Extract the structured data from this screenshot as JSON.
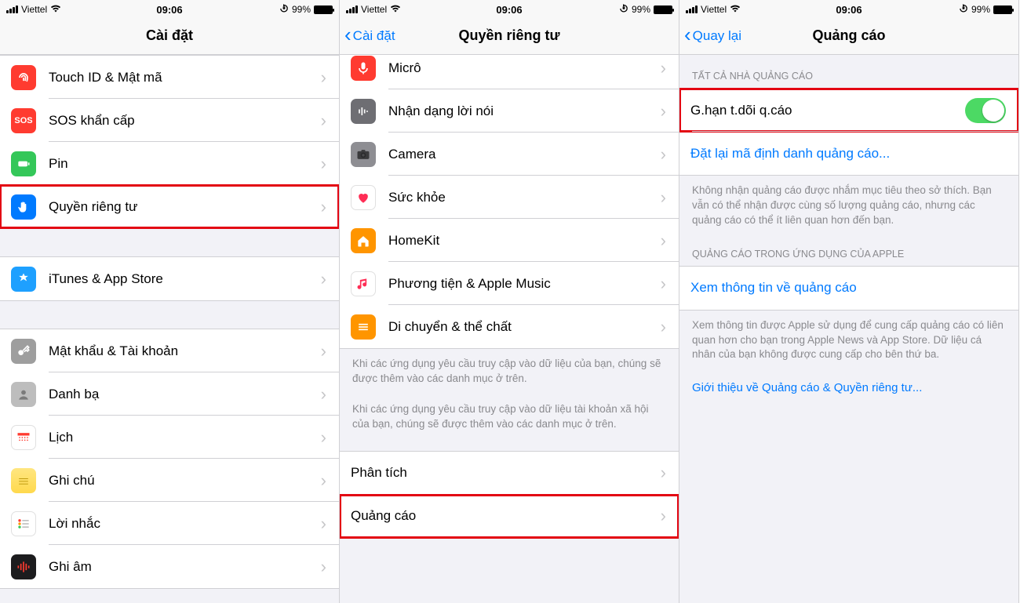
{
  "status": {
    "carrier": "Viettel",
    "time": "09:06",
    "battery": "99%"
  },
  "screen1": {
    "title": "Cài đặt",
    "groups": [
      [
        {
          "key": "touchid",
          "label": "Touch ID & Mật mã",
          "iconColor": "#ff3b30",
          "icon": "fingerprint"
        },
        {
          "key": "sos",
          "label": "SOS khẩn cấp",
          "iconColor": "#ff3b30",
          "icon": "sos"
        },
        {
          "key": "battery",
          "label": "Pin",
          "iconColor": "#34c759",
          "icon": "battery"
        },
        {
          "key": "privacy",
          "label": "Quyền riêng tư",
          "iconColor": "#007aff",
          "icon": "hand",
          "highlight": true
        }
      ],
      [
        {
          "key": "itunes",
          "label": "iTunes & App Store",
          "iconColor": "#1e90ff",
          "icon": "appstore"
        }
      ],
      [
        {
          "key": "passwords",
          "label": "Mật khẩu & Tài khoản",
          "iconColor": "#9e9e9e",
          "icon": "key"
        },
        {
          "key": "contacts",
          "label": "Danh bạ",
          "iconColor": "#bdbdbd",
          "icon": "contacts"
        },
        {
          "key": "calendar",
          "label": "Lịch",
          "iconColor": "#ffffff",
          "icon": "calendar"
        },
        {
          "key": "notes",
          "label": "Ghi chú",
          "iconColor": "#ffe066",
          "icon": "notes"
        },
        {
          "key": "reminders",
          "label": "Lời nhắc",
          "iconColor": "#ffffff",
          "icon": "reminders"
        },
        {
          "key": "voicememo",
          "label": "Ghi âm",
          "iconColor": "#1c1c1e",
          "icon": "wave"
        }
      ]
    ]
  },
  "screen2": {
    "back": "Cài đặt",
    "title": "Quyền riêng tư",
    "rows": [
      {
        "key": "micro",
        "label": "Micrô",
        "iconColor": "#ff3b30",
        "icon": "mic",
        "clipped": true
      },
      {
        "key": "speech",
        "label": "Nhận dạng lời nói",
        "iconColor": "#6e6e73",
        "icon": "speech"
      },
      {
        "key": "camera",
        "label": "Camera",
        "iconColor": "#8e8e93",
        "icon": "camera"
      },
      {
        "key": "health",
        "label": "Sức khỏe",
        "iconColor": "#ffffff",
        "icon": "health"
      },
      {
        "key": "homekit",
        "label": "HomeKit",
        "iconColor": "#ff9500",
        "icon": "home"
      },
      {
        "key": "media",
        "label": "Phương tiện & Apple Music",
        "iconColor": "#ffffff",
        "icon": "music"
      },
      {
        "key": "motion",
        "label": "Di chuyển & thể chất",
        "iconColor": "#ff9500",
        "icon": "motion"
      }
    ],
    "footer1": "Khi các ứng dụng yêu cầu truy cập vào dữ liệu của bạn, chúng sẽ được thêm vào các danh mục ở trên.",
    "footer2": "Khi các ứng dụng yêu cầu truy cập vào dữ liệu tài khoản xã hội của bạn, chúng sẽ được thêm vào các danh mục ở trên.",
    "rows2": [
      {
        "key": "analytics",
        "label": "Phân tích"
      },
      {
        "key": "ads",
        "label": "Quảng cáo",
        "highlight": true
      }
    ]
  },
  "screen3": {
    "back": "Quay lại",
    "title": "Quảng cáo",
    "section1_header": "TẤT CẢ NHÀ QUẢNG CÁO",
    "limit_label": "G.hạn t.dõi q.cáo",
    "reset_label": "Đặt lại mã định danh quảng cáo...",
    "footer1": "Không nhận quảng cáo được nhắm mục tiêu theo sở thích. Bạn vẫn có thể nhận được cùng số lượng quảng cáo, nhưng các quảng cáo có thể ít liên quan hơn đến bạn.",
    "section2_header": "QUẢNG CÁO TRONG ỨNG DỤNG CỦA APPLE",
    "view_label": "Xem thông tin về quảng cáo",
    "footer2": "Xem thông tin được Apple sử dụng để cung cấp quảng cáo có liên quan hơn cho bạn trong Apple News và App Store. Dữ liệu cá nhân của bạn không được cung cấp cho bên thứ ba.",
    "about_link": "Giới thiệu về Quảng cáo & Quyền riêng tư..."
  }
}
